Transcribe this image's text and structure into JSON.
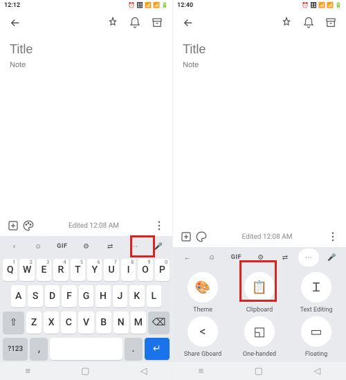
{
  "left": {
    "status": {
      "time": "12:12",
      "right": "⏰ 🗄 📶 📶 🔋"
    },
    "title_ph": "Title",
    "note_ph": "Note",
    "edited": "Edited 12:08 AM",
    "kb_tools": {
      "gif": "GIF"
    },
    "row1": [
      "Q",
      "W",
      "E",
      "R",
      "T",
      "Y",
      "U",
      "I",
      "O",
      "P"
    ],
    "row1_sup": [
      "1",
      "2",
      "3",
      "4",
      "5",
      "6",
      "7",
      "8",
      "9",
      "0"
    ],
    "row2": [
      "A",
      "S",
      "D",
      "F",
      "G",
      "H",
      "J",
      "K",
      "L"
    ],
    "row3": [
      "Z",
      "X",
      "C",
      "V",
      "B",
      "N",
      "M"
    ],
    "row4": {
      "sym": "?123",
      "comma": ",",
      "period": "."
    }
  },
  "right": {
    "status": {
      "time": "12:40",
      "right": "⏰ 🗄 📶 📶 🔋"
    },
    "title_ph": "Title",
    "note_ph": "Note",
    "edited": "Edited 12:08 AM",
    "kb_tools": {
      "gif": "GIF"
    },
    "panel": [
      {
        "label": "Theme"
      },
      {
        "label": "Clipboard"
      },
      {
        "label": "Text Editing"
      },
      {
        "label": "Share Gboard"
      },
      {
        "label": "One-handed"
      },
      {
        "label": "Floating"
      }
    ]
  }
}
